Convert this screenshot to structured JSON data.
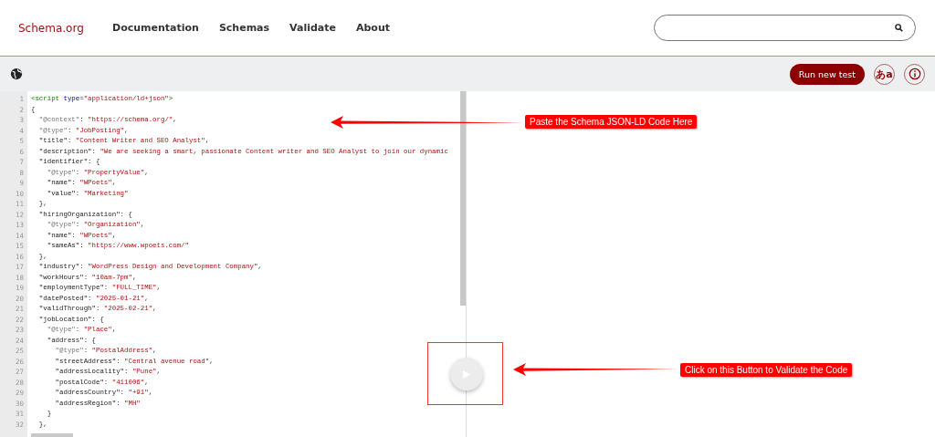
{
  "header": {
    "logo": "Schema.org",
    "nav": [
      "Documentation",
      "Schemas",
      "Validate",
      "About"
    ]
  },
  "toolbar": {
    "run_button": "Run new test",
    "language_button": "あa"
  },
  "editor": {
    "lines": [
      [
        {
          "kind": "tag",
          "t": "<script"
        },
        {
          "kind": "attr",
          "t": " type"
        },
        {
          "kind": "p",
          "t": "="
        },
        {
          "kind": "str",
          "t": "\"application/ld+json\""
        },
        {
          "kind": "tag",
          "t": ">"
        }
      ],
      [
        {
          "kind": "p",
          "t": "{"
        }
      ],
      [
        {
          "kind": "meta",
          "t": "  \"@context\""
        },
        {
          "kind": "p",
          "t": ": "
        },
        {
          "kind": "str",
          "t": "\"https://schema.org/\""
        },
        {
          "kind": "p",
          "t": ","
        }
      ],
      [
        {
          "kind": "meta",
          "t": "  \"@type\""
        },
        {
          "kind": "p",
          "t": ": "
        },
        {
          "kind": "str",
          "t": "\"JobPosting\""
        },
        {
          "kind": "p",
          "t": ","
        }
      ],
      [
        {
          "kind": "key",
          "t": "  \"title\""
        },
        {
          "kind": "p",
          "t": ": "
        },
        {
          "kind": "str",
          "t": "\"Content Writer and SEO Analyst\""
        },
        {
          "kind": "p",
          "t": ","
        }
      ],
      [
        {
          "kind": "key",
          "t": "  \"description\""
        },
        {
          "kind": "p",
          "t": ": "
        },
        {
          "kind": "str",
          "t": "\"We are seeking a smart, passionate Content writer and SEO Analyst to join our dynamic"
        }
      ],
      [
        {
          "kind": "key",
          "t": "  \"identifier\""
        },
        {
          "kind": "p",
          "t": ": {"
        }
      ],
      [
        {
          "kind": "meta",
          "t": "    \"@type\""
        },
        {
          "kind": "p",
          "t": ": "
        },
        {
          "kind": "str",
          "t": "\"PropertyValue\""
        },
        {
          "kind": "p",
          "t": ","
        }
      ],
      [
        {
          "kind": "key",
          "t": "    \"name\""
        },
        {
          "kind": "p",
          "t": ": "
        },
        {
          "kind": "str",
          "t": "\"WPoets\""
        },
        {
          "kind": "p",
          "t": ","
        }
      ],
      [
        {
          "kind": "key",
          "t": "    \"value\""
        },
        {
          "kind": "p",
          "t": ": "
        },
        {
          "kind": "str",
          "t": "\"Marketing\""
        }
      ],
      [
        {
          "kind": "p",
          "t": "  },"
        }
      ],
      [
        {
          "kind": "key",
          "t": "  \"hiringOrganization\""
        },
        {
          "kind": "p",
          "t": ": {"
        }
      ],
      [
        {
          "kind": "meta",
          "t": "    \"@type\""
        },
        {
          "kind": "p",
          "t": ": "
        },
        {
          "kind": "str",
          "t": "\"Organization\""
        },
        {
          "kind": "p",
          "t": ","
        }
      ],
      [
        {
          "kind": "key",
          "t": "    \"name\""
        },
        {
          "kind": "p",
          "t": ": "
        },
        {
          "kind": "str",
          "t": "\"WPoets\""
        },
        {
          "kind": "p",
          "t": ","
        }
      ],
      [
        {
          "kind": "key",
          "t": "    \"sameAs\""
        },
        {
          "kind": "p",
          "t": ": "
        },
        {
          "kind": "str",
          "t": "\"https://www.wpoets.com/\""
        }
      ],
      [
        {
          "kind": "p",
          "t": "  },"
        }
      ],
      [
        {
          "kind": "key",
          "t": "  \"industry\""
        },
        {
          "kind": "p",
          "t": ": "
        },
        {
          "kind": "str",
          "t": "\"WordPress Design and Development Company\""
        },
        {
          "kind": "p",
          "t": ","
        }
      ],
      [
        {
          "kind": "key",
          "t": "  \"workHours\""
        },
        {
          "kind": "p",
          "t": ": "
        },
        {
          "kind": "str",
          "t": "\"10am-7pm\""
        },
        {
          "kind": "p",
          "t": ","
        }
      ],
      [
        {
          "kind": "key",
          "t": "  \"employmentType\""
        },
        {
          "kind": "p",
          "t": ": "
        },
        {
          "kind": "str",
          "t": "\"FULL_TIME\""
        },
        {
          "kind": "p",
          "t": ","
        }
      ],
      [
        {
          "kind": "key",
          "t": "  \"datePosted\""
        },
        {
          "kind": "p",
          "t": ": "
        },
        {
          "kind": "str",
          "t": "\"2025-01-21\""
        },
        {
          "kind": "p",
          "t": ","
        }
      ],
      [
        {
          "kind": "key",
          "t": "  \"validThrough\""
        },
        {
          "kind": "p",
          "t": ": "
        },
        {
          "kind": "str",
          "t": "\"2025-02-21\""
        },
        {
          "kind": "p",
          "t": ","
        }
      ],
      [
        {
          "kind": "key",
          "t": "  \"jobLocation\""
        },
        {
          "kind": "p",
          "t": ": {"
        }
      ],
      [
        {
          "kind": "meta",
          "t": "    \"@type\""
        },
        {
          "kind": "p",
          "t": ": "
        },
        {
          "kind": "str",
          "t": "\"Place\""
        },
        {
          "kind": "p",
          "t": ","
        }
      ],
      [
        {
          "kind": "key",
          "t": "    \"address\""
        },
        {
          "kind": "p",
          "t": ": {"
        }
      ],
      [
        {
          "kind": "meta",
          "t": "      \"@type\""
        },
        {
          "kind": "p",
          "t": ": "
        },
        {
          "kind": "str",
          "t": "\"PostalAddress\""
        },
        {
          "kind": "p",
          "t": ","
        }
      ],
      [
        {
          "kind": "key",
          "t": "      \"streetAddress\""
        },
        {
          "kind": "p",
          "t": ": "
        },
        {
          "kind": "str",
          "t": "\"Central avenue road\""
        },
        {
          "kind": "p",
          "t": ","
        }
      ],
      [
        {
          "kind": "key",
          "t": "      \"addressLocality\""
        },
        {
          "kind": "p",
          "t": ": "
        },
        {
          "kind": "str",
          "t": "\"Pune\""
        },
        {
          "kind": "p",
          "t": ","
        }
      ],
      [
        {
          "kind": "key",
          "t": "      \"postalCode\""
        },
        {
          "kind": "p",
          "t": ": "
        },
        {
          "kind": "str",
          "t": "\"411006\""
        },
        {
          "kind": "p",
          "t": ","
        }
      ],
      [
        {
          "kind": "key",
          "t": "      \"addressCountry\""
        },
        {
          "kind": "p",
          "t": ": "
        },
        {
          "kind": "str",
          "t": "\"+91\""
        },
        {
          "kind": "p",
          "t": ","
        }
      ],
      [
        {
          "kind": "key",
          "t": "      \"addressRegion\""
        },
        {
          "kind": "p",
          "t": ": "
        },
        {
          "kind": "str",
          "t": "\"MH\""
        }
      ],
      [
        {
          "kind": "p",
          "t": "    }"
        }
      ],
      [
        {
          "kind": "p",
          "t": "  },"
        }
      ]
    ],
    "line_numbers": [
      "1",
      "2",
      "3",
      "4",
      "5",
      "6",
      "7",
      "8",
      "9",
      "10",
      "11",
      "12",
      "13",
      "14",
      "15",
      "16",
      "17",
      "18",
      "19",
      "20",
      "21",
      "22",
      "23",
      "24",
      "25",
      "26",
      "27",
      "28",
      "29",
      "30",
      "31",
      "32"
    ]
  },
  "annotations": [
    "Paste the Schema JSON-LD Code Here",
    "Click on this Button to Validate the Code"
  ]
}
